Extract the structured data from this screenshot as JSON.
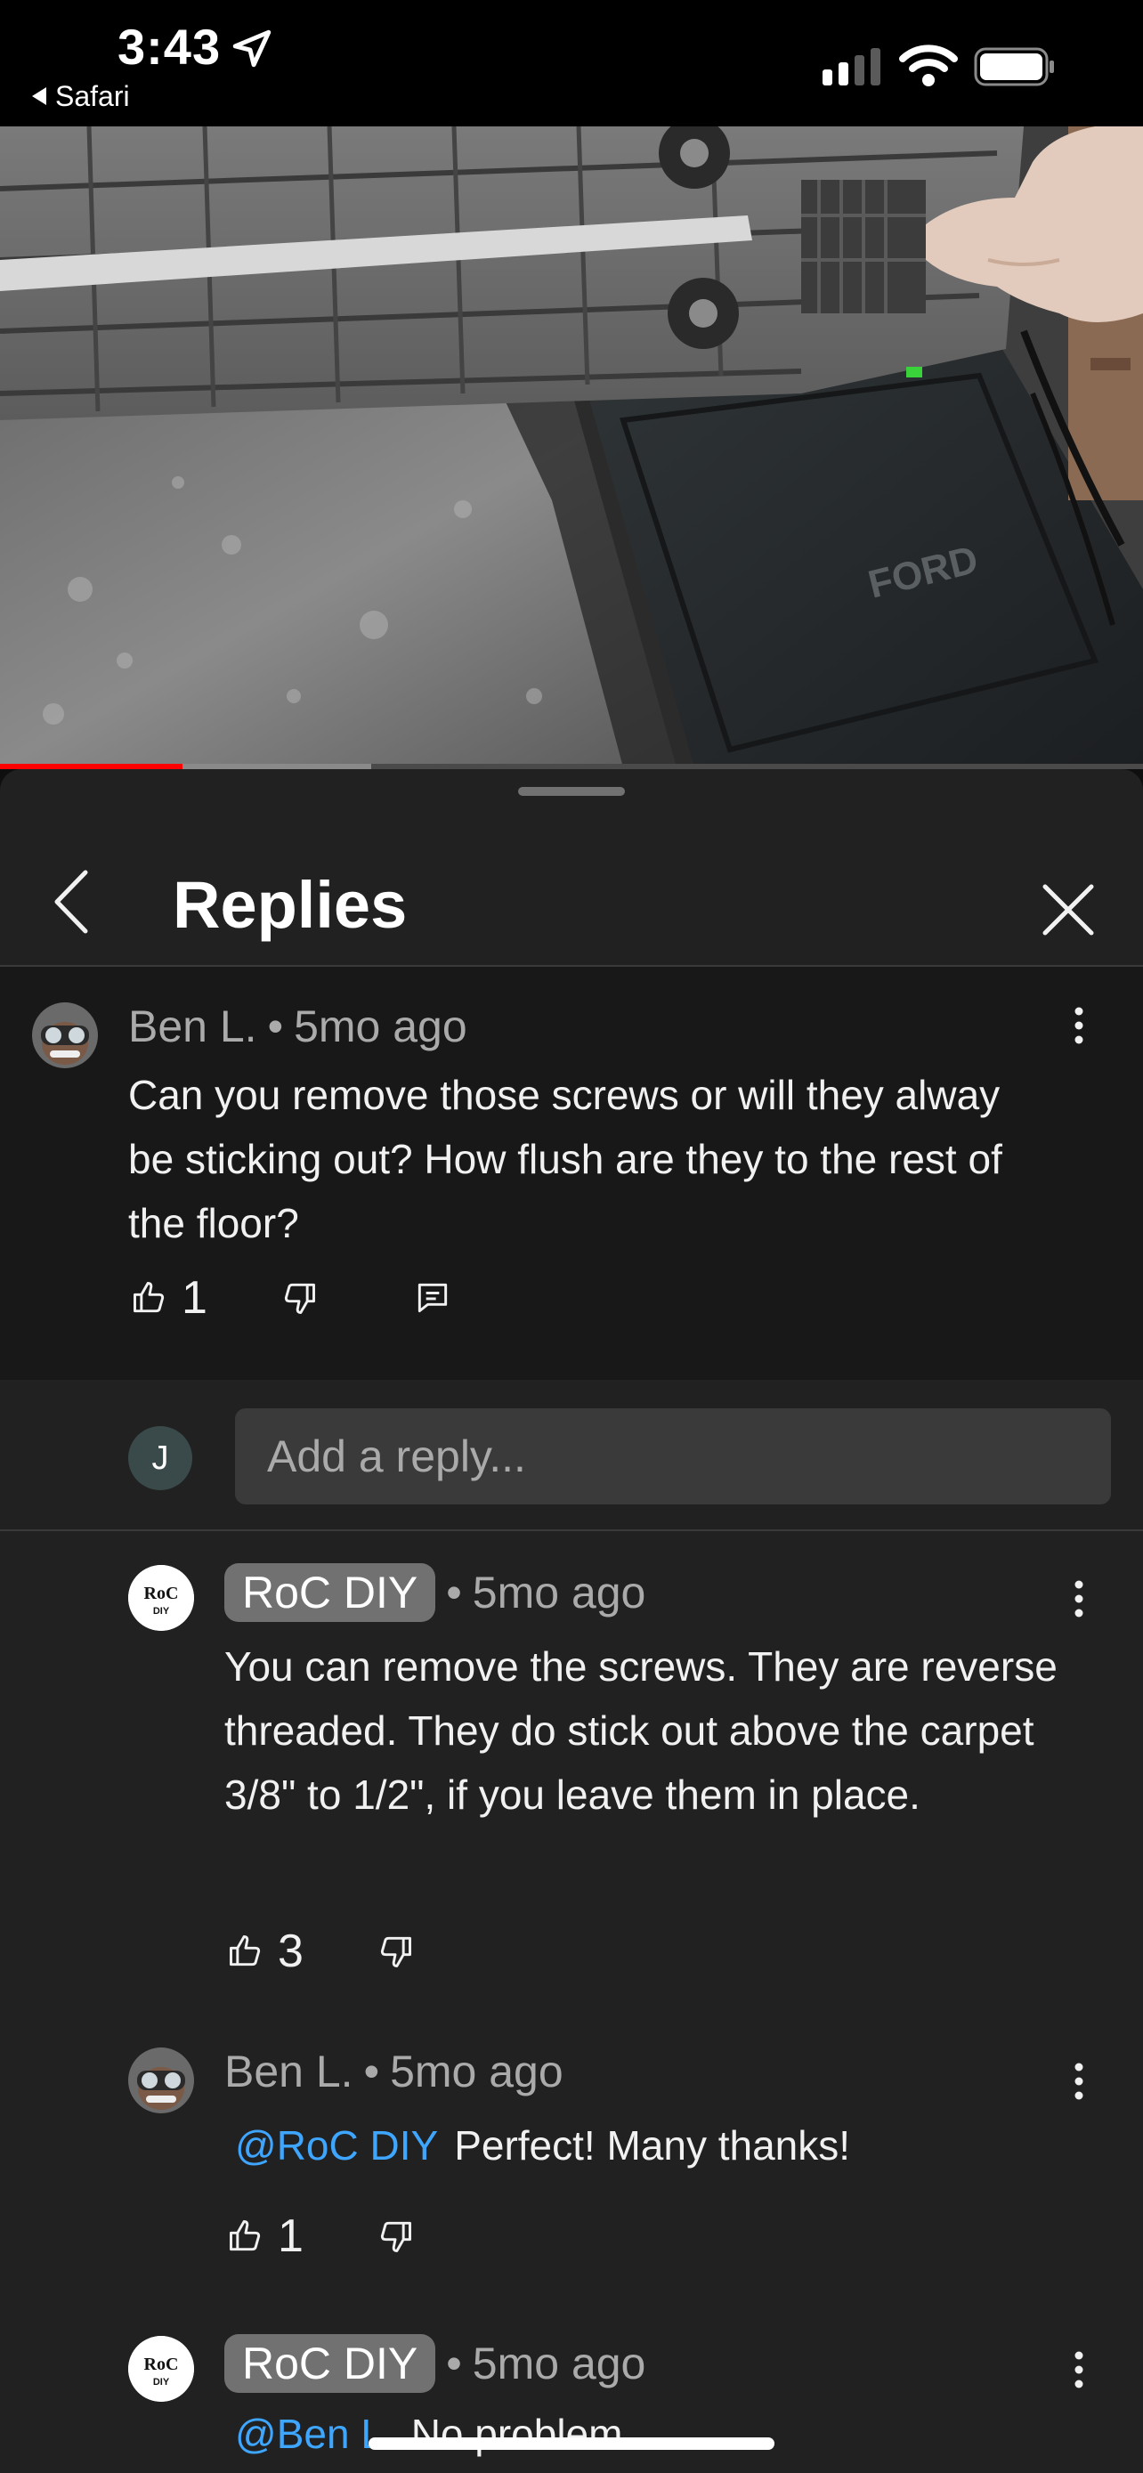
{
  "status_bar": {
    "time": "3:43",
    "back_label": "Safari"
  },
  "video": {
    "progress_played": 0.16,
    "progress_buffered": 0.325,
    "overlay_text": "FORD"
  },
  "sheet": {
    "title": "Replies"
  },
  "parent_comment": {
    "author": "Ben L.",
    "age": "5mo ago",
    "text": "Can you remove those screws or will they alway be sticking out? How flush are they to the rest of the floor?",
    "likes": "1"
  },
  "reply_box": {
    "user_initial": "J",
    "placeholder": "Add a reply..."
  },
  "replies": [
    {
      "author": "RoC DIY",
      "age": "5mo ago",
      "text": "You can remove the screws. They are reverse threaded. They do stick out above the carpet 3/8\" to 1/2\", if you leave them in place.",
      "likes": "3"
    },
    {
      "author": "Ben L.",
      "age": "5mo ago",
      "mention": "@RoC DIY",
      "text": "Perfect! Many thanks!",
      "likes": "1"
    },
    {
      "author": "RoC DIY",
      "age": "5mo ago",
      "mention": "@Ben L.",
      "text": "No problem"
    }
  ],
  "avatar_logo_text": {
    "top": "RoC",
    "bottom": "DIY"
  },
  "colors": {
    "accent_red": "#ff0000",
    "mention_blue": "#3ea6ff",
    "sheet_bg": "#212121",
    "comment_bg": "#181818"
  }
}
